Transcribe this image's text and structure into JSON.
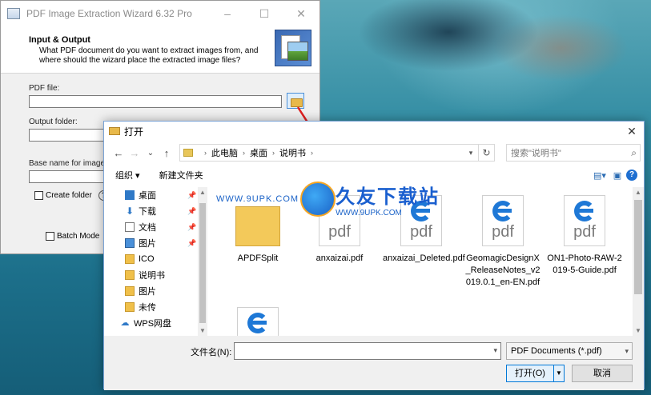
{
  "wizard": {
    "title": "PDF Image Extraction Wizard 6.32 Pro",
    "window_controls": [
      "–",
      "☐",
      "✕"
    ],
    "header_title": "Input & Output",
    "header_desc": "What PDF document do you want to extract images from, and where should the wizard place the extracted image files?",
    "pdf_file_label": "PDF file:",
    "output_folder_label": "Output folder:",
    "base_name_label": "Base name for images:",
    "create_folder_label": "Create folder",
    "help_label": "?",
    "batch_mode_label": "Batch Mode"
  },
  "dialog": {
    "title": "打开",
    "close": "✕",
    "nav": {
      "back": "←",
      "forward": "→",
      "up_list": "⌄",
      "up": "↑"
    },
    "breadcrumb": [
      "此电脑",
      "桌面",
      "说明书"
    ],
    "refresh": "↻",
    "search_placeholder": "搜索\"说明书\"",
    "toolbar": {
      "organize": "组织 ▾",
      "new_folder": "新建文件夹"
    },
    "nav_items": [
      {
        "label": "桌面",
        "icon": "desktop-icon",
        "pinned": true
      },
      {
        "label": "下载",
        "icon": "download-icon",
        "pinned": true
      },
      {
        "label": "文档",
        "icon": "document-icon",
        "pinned": true
      },
      {
        "label": "图片",
        "icon": "pictures-icon",
        "pinned": true
      },
      {
        "label": "ICO",
        "icon": "folder-icon",
        "pinned": false
      },
      {
        "label": "说明书",
        "icon": "folder-icon",
        "pinned": false
      },
      {
        "label": "图片",
        "icon": "folder-icon",
        "pinned": false
      },
      {
        "label": "未传",
        "icon": "folder-icon",
        "pinned": false
      },
      {
        "label": "WPS网盘",
        "icon": "cloud-icon",
        "pinned": false
      }
    ],
    "files": [
      {
        "name": "APDFSplit",
        "type": "folder"
      },
      {
        "name": "anxaizai.pdf",
        "type": "pdf"
      },
      {
        "name": "anxaizai_Deleted.pdf",
        "type": "pdf-edge"
      },
      {
        "name": "GeomagicDesignX_ReleaseNotes_v2019.0.1_en-EN.pdf",
        "type": "pdf-edge"
      },
      {
        "name": "ON1-Photo-RAW-2019-5-Guide.pdf",
        "type": "pdf-edge"
      },
      {
        "name": "",
        "type": "pdf-edge"
      }
    ],
    "pdf_text": "pdf",
    "filename_label": "文件名(N):",
    "filename_value": "",
    "filter_value": "PDF Documents (*.pdf)",
    "open_label": "打开(O)",
    "cancel_label": "取消"
  },
  "watermark": {
    "url_left": "WWW.9UPK.COM",
    "big": "久友下载站",
    "url_small": "WWW.9UPK.COM"
  }
}
